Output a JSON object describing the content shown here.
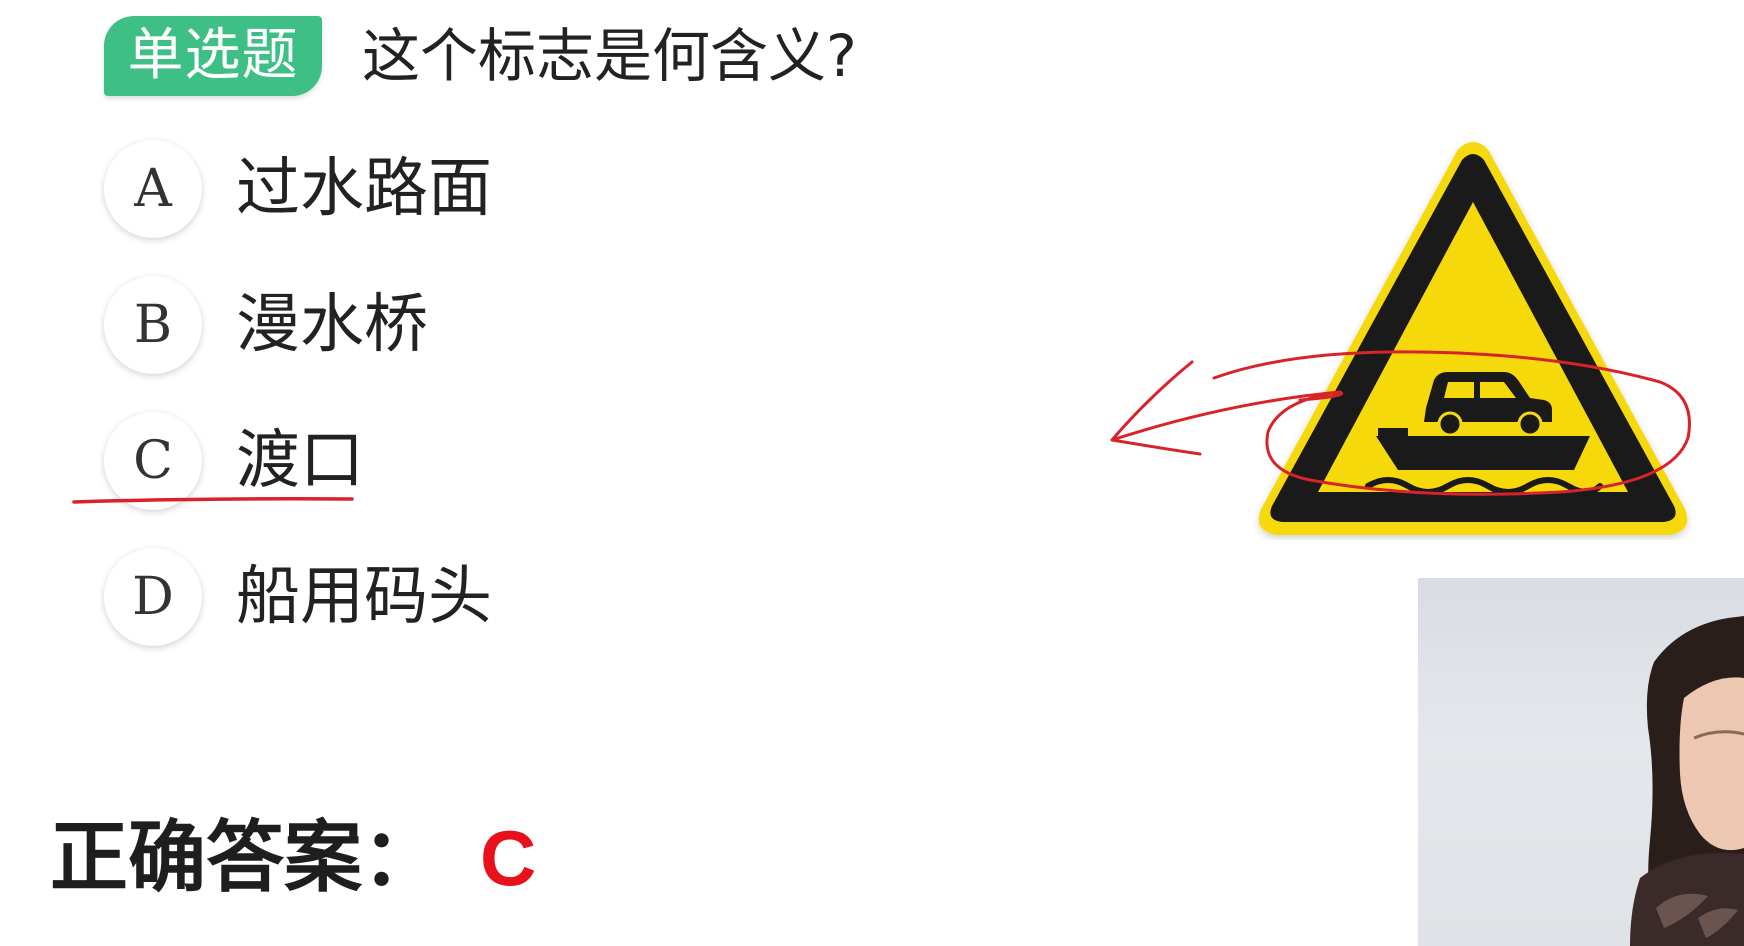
{
  "question": {
    "type_tag": "单选题",
    "text": "这个标志是何含义?"
  },
  "options": [
    {
      "letter": "A",
      "text": "过水路面"
    },
    {
      "letter": "B",
      "text": "漫水桥"
    },
    {
      "letter": "C",
      "text": "渡口"
    },
    {
      "letter": "D",
      "text": "船用码头"
    }
  ],
  "answer": {
    "label": "正确答案：",
    "value": "C"
  },
  "sign": {
    "icon": "ferry-warning-sign-icon",
    "fill_color": "#f5d90a",
    "border_color": "#1a1a1a"
  },
  "annotations": {
    "color": "#d9232b",
    "underlined_option": "C"
  },
  "colors": {
    "tag_background": "#3dbf86",
    "answer_color": "#e8101a"
  }
}
